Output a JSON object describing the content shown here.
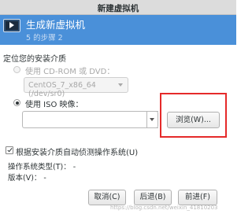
{
  "window": {
    "title": "新建虚拟机"
  },
  "header": {
    "title": "生成新虚拟机",
    "step": "5 的步骤 2"
  },
  "install_media": {
    "section_label": "定位您的安装介质",
    "cdrom_option_label": "使用 CD-ROM 或 DVD：",
    "cdrom_option_selected": false,
    "cdrom_option_enabled": false,
    "cdrom_device_value": "CentOS_7_x86_64 (/dev/sr0)",
    "iso_option_label": "使用 ISO 映像：",
    "iso_option_selected": true,
    "iso_path_value": "",
    "browse_button_label": "浏览(W)..."
  },
  "detect_os": {
    "label": "根据安装介质自动侦测操作系统(U)",
    "checked": true,
    "os_type_label": "操作系统类型(T)：",
    "os_type_value": "-",
    "version_label": "版本(V)：",
    "version_value": "-"
  },
  "buttons": {
    "cancel": "取消(C)",
    "back": "后退(B)",
    "forward": "前进(F)"
  },
  "watermark": "https://blog.csdn.net/weixin_41810203",
  "colors": {
    "header_bg": "#4a90d9",
    "highlight": "#e52a2a"
  }
}
